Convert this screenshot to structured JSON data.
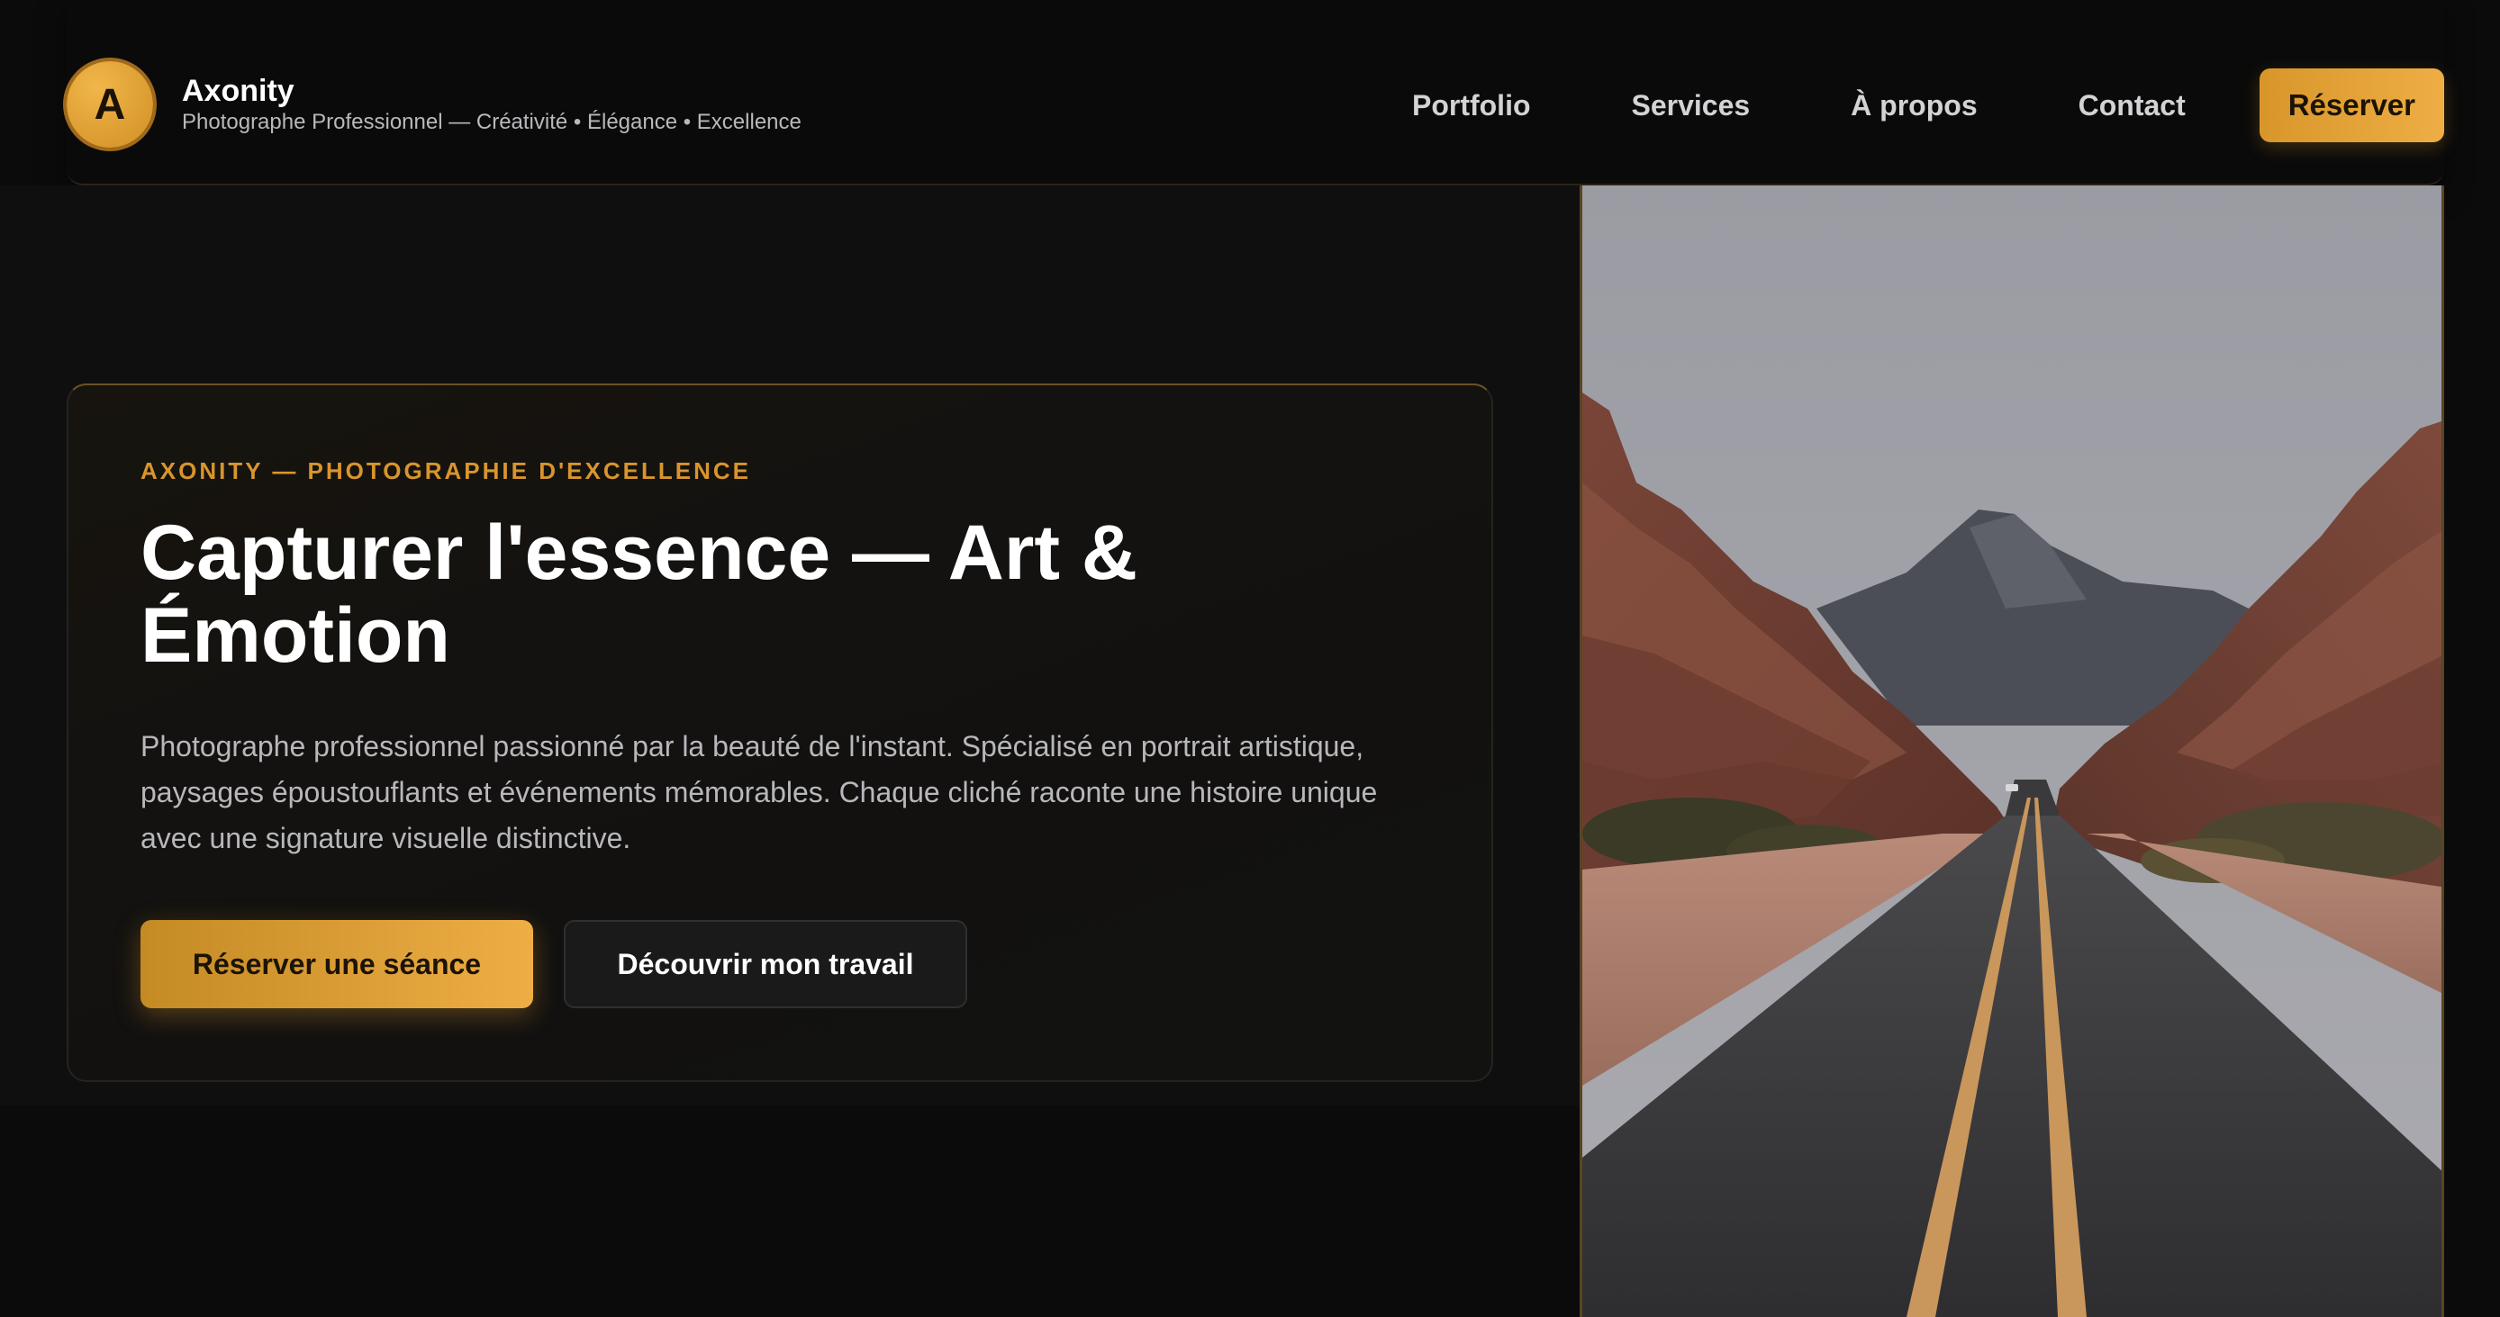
{
  "header": {
    "logo_letter": "A",
    "brand_name": "Axonity",
    "tagline": "Photographe Professionnel — Créativité • Élégance • Excellence",
    "nav": [
      {
        "label": "Portfolio"
      },
      {
        "label": "Services"
      },
      {
        "label": "À propos"
      },
      {
        "label": "Contact"
      }
    ],
    "cta_label": "Réserver"
  },
  "hero": {
    "eyebrow": "AXONITY — PHOTOGRAPHIE D'EXCELLENCE",
    "title": "Capturer l'essence — Art & Émotion",
    "description": "Photographe professionnel passionné par la beauté de l'instant. Spécialisé en portrait artistique, paysages époustouflants et événements mémorables. Chaque cliché raconte une histoire unique avec une signature visuelle distinctive.",
    "primary_button": "Réserver une séance",
    "secondary_button": "Découvrir mon travail"
  },
  "colors": {
    "accent": "#E0A035",
    "background": "#0B0B0C",
    "card": "#141210"
  }
}
